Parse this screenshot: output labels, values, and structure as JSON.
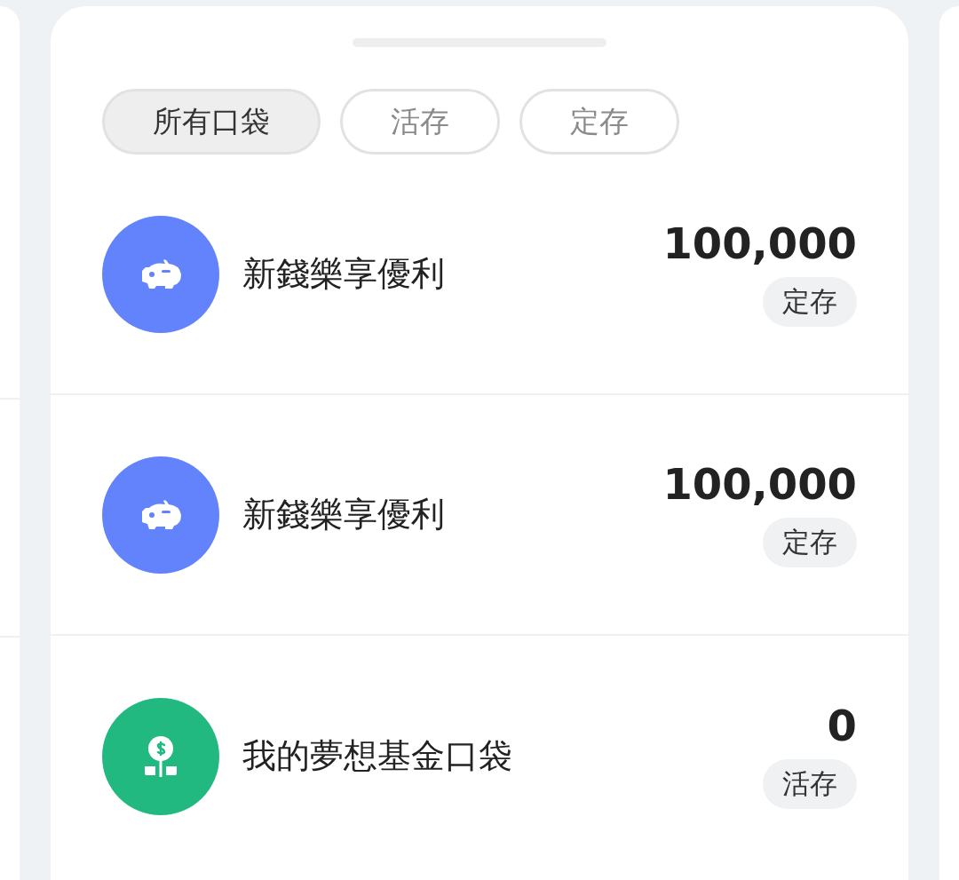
{
  "filters": [
    {
      "label": "所有口袋",
      "selected": true
    },
    {
      "label": "活存",
      "selected": false
    },
    {
      "label": "定存",
      "selected": false
    }
  ],
  "pockets": [
    {
      "kind": "piggy",
      "color": "#6283fb",
      "name": "新錢樂享優利",
      "amount": "100,000",
      "type": "定存"
    },
    {
      "kind": "piggy",
      "color": "#6283fb",
      "name": "新錢樂享優利",
      "amount": "100,000",
      "type": "定存"
    },
    {
      "kind": "plant",
      "color": "#22b980",
      "name": "我的夢想基金口袋",
      "amount": "0",
      "type": "活存"
    }
  ]
}
